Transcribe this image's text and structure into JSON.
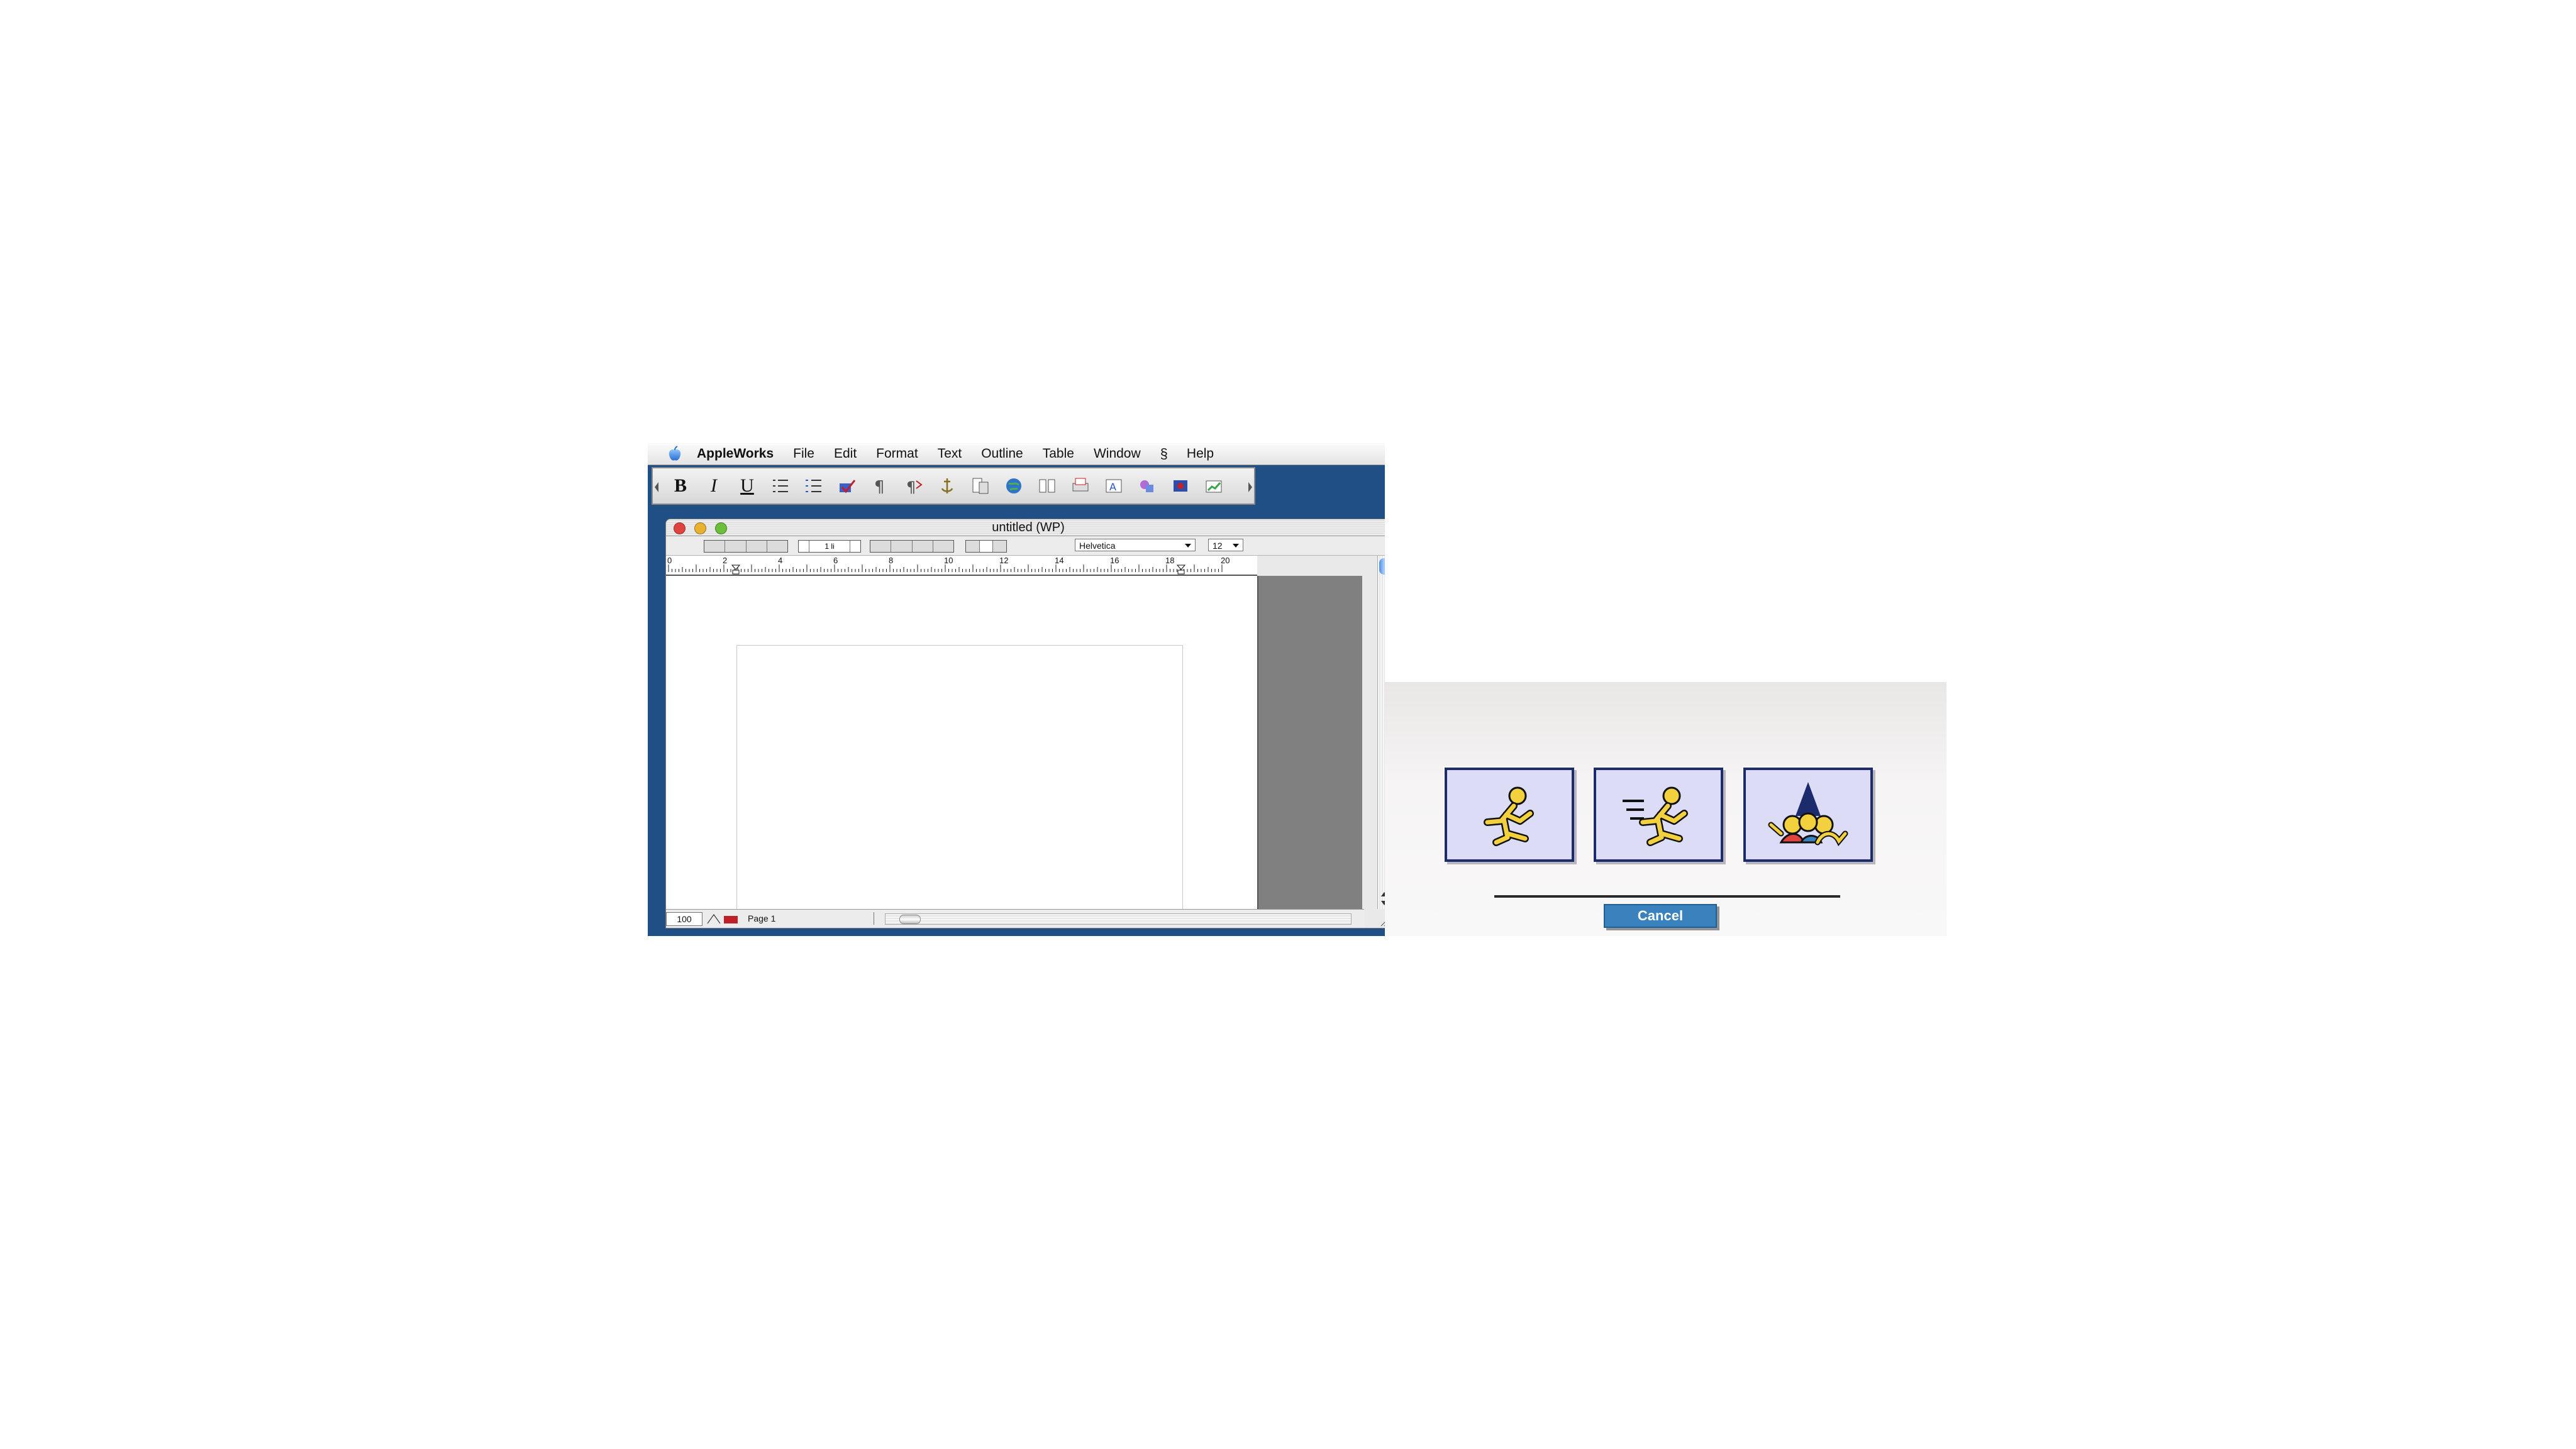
{
  "menubar": {
    "app_name": "AppleWorks",
    "menus": [
      "File",
      "Edit",
      "Format",
      "Text",
      "Outline",
      "Table",
      "Window"
    ],
    "help": "Help"
  },
  "button_bar": {
    "bold": "B",
    "italic": "I",
    "underline": "U"
  },
  "document": {
    "title": "untitled (WP)",
    "font_name": "Helvetica",
    "font_size": "12",
    "line_spacing": "1 li",
    "ruler_labels": [
      "0",
      "2",
      "4",
      "6",
      "8",
      "10",
      "12",
      "14",
      "16",
      "18",
      "20"
    ],
    "zoom": "100",
    "page_label": "Page 1"
  },
  "aim_dialog": {
    "cancel_label": "Cancel"
  },
  "colors": {
    "desktop": "#1f4f85",
    "aim_frame": "#1c2b6b",
    "aim_panel": "#dcdcf7",
    "aim_yellow": "#f3d03e",
    "cancel_button": "#3a82bd"
  }
}
